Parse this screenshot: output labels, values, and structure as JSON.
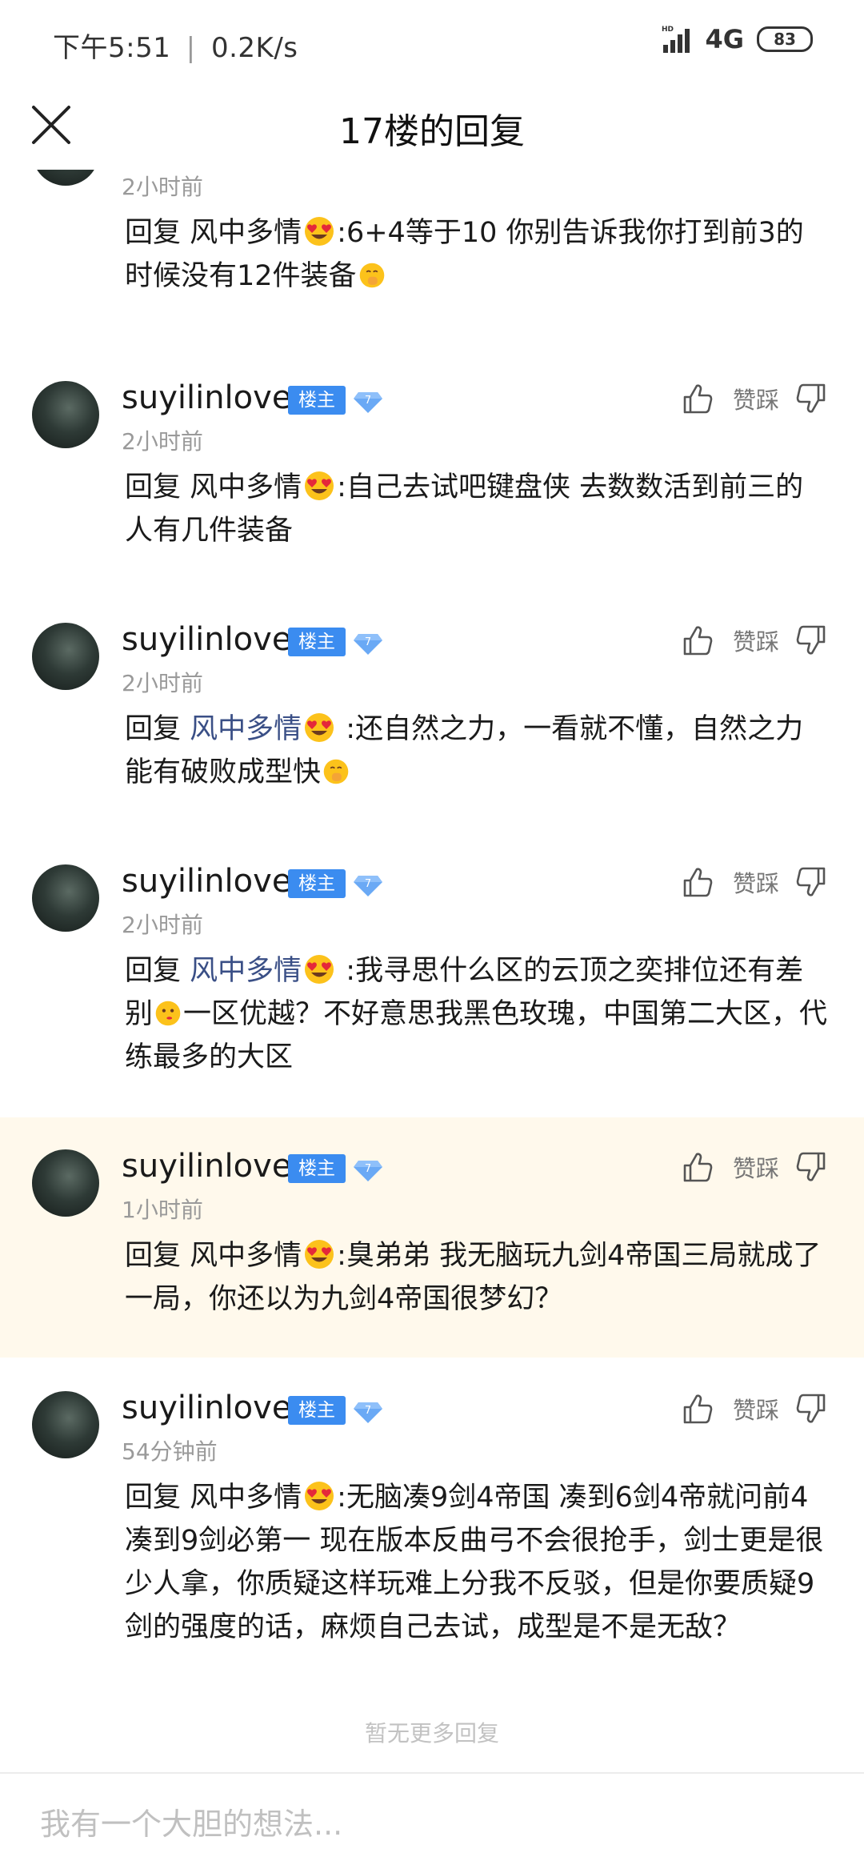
{
  "status_bar": {
    "time": "下午5:51",
    "speed": "0.2K/s",
    "network": "4G",
    "battery": "83"
  },
  "header": {
    "title": "17楼的回复"
  },
  "replies": [
    {
      "username": "",
      "time": "2小时前",
      "reply_prefix": "回复",
      "mention": "风中多情",
      "text": ":6+4等于10 你别告诉我你打到前3的时候没有12件装备"
    },
    {
      "username": "suyilinlove",
      "badge": "楼主",
      "level": "7",
      "time": "2小时前",
      "reply_prefix": "回复",
      "mention": "风中多情",
      "text": ":自己去试吧键盘侠 去数数活到前三的人有几件装备"
    },
    {
      "username": "suyilinlove",
      "badge": "楼主",
      "level": "7",
      "time": "2小时前",
      "reply_prefix": "回复",
      "mention": "风中多情",
      "text": " :还自然之力，一看就不懂，自然之力能有破败成型快"
    },
    {
      "username": "suyilinlove",
      "badge": "楼主",
      "level": "7",
      "time": "2小时前",
      "reply_prefix": "回复",
      "mention": "风中多情",
      "text_a": " :我寻思什么区的云顶之奕排位还有差别",
      "text_b": "一区优越？不好意思我黑色玫瑰，中国第二大区，代练最多的大区"
    },
    {
      "username": "suyilinlove",
      "badge": "楼主",
      "level": "7",
      "time": "1小时前",
      "reply_prefix": "回复",
      "mention": "风中多情",
      "text": ":臭弟弟 我无脑玩九剑4帝国三局就成了一局，你还以为九剑4帝国很梦幻？"
    },
    {
      "username": "suyilinlove",
      "badge": "楼主",
      "level": "7",
      "time": "54分钟前",
      "reply_prefix": "回复",
      "mention": "风中多情",
      "text": ":无脑凑9剑4帝国 凑到6剑4帝就问前4 凑到9剑必第一 现在版本反曲弓不会很抢手，剑士更是很少人拿，你质疑这样玩难上分我不反驳，但是你要质疑9剑的强度的话，麻烦自己去试，成型是不是无敌？"
    }
  ],
  "vote": {
    "label": "赞踩"
  },
  "footer": {
    "no_more": "暂无更多回复",
    "input_placeholder": "我有一个大胆的想法..."
  },
  "colors": {
    "badge": "#3b8cf0",
    "highlight_bg": "#fff9ec",
    "mention": "#3a4f86",
    "muted": "#9a9a9a"
  },
  "icons": [
    "close-icon",
    "thumbs-up-icon",
    "thumbs-down-icon",
    "level-diamond-icon",
    "heart-eyes-emoji-icon",
    "face-hand-over-mouth-emoji-icon",
    "thinking-face-emoji-icon"
  ]
}
